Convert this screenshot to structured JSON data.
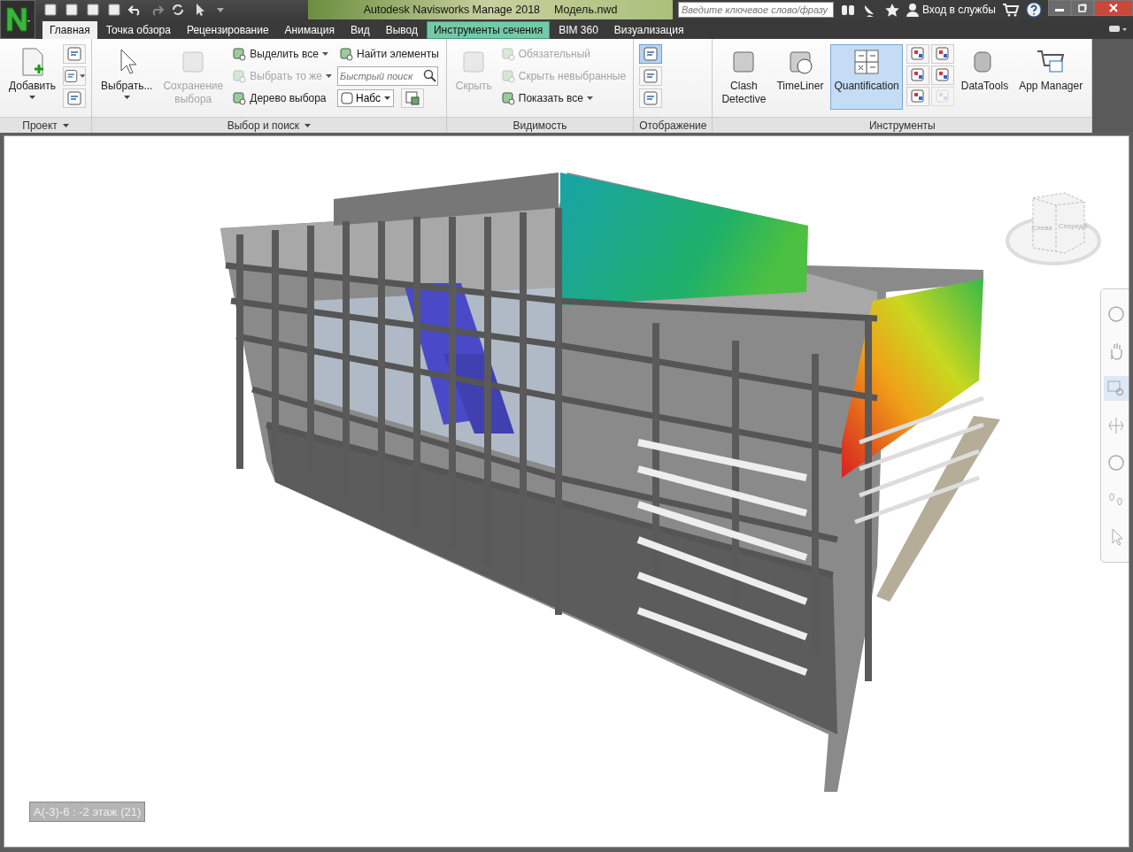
{
  "title_bar": {
    "title": "Autodesk Navisworks Manage 2018",
    "file": "Модель.nwd",
    "search": {
      "placeholder": "Введите ключевое слово/фразу"
    },
    "sign_in": "Вход в службы"
  },
  "tabs": [
    {
      "label": "Главная",
      "selected": true,
      "highlighted": false
    },
    {
      "label": "Точка обзора",
      "selected": false,
      "highlighted": false
    },
    {
      "label": "Рецензирование",
      "selected": false,
      "highlighted": false
    },
    {
      "label": "Анимация",
      "selected": false,
      "highlighted": false
    },
    {
      "label": "Вид",
      "selected": false,
      "highlighted": false
    },
    {
      "label": "Вывод",
      "selected": false,
      "highlighted": false
    },
    {
      "label": "Инструменты сечения",
      "selected": false,
      "highlighted": true
    },
    {
      "label": "BIM 360",
      "selected": false,
      "highlighted": false
    },
    {
      "label": "Визуализация",
      "selected": false,
      "highlighted": false
    }
  ],
  "ribbon_panels": [
    {
      "label": "Проект",
      "menu": true,
      "groups": [
        {
          "kind": "large",
          "label": [
            "Добавить"
          ],
          "dropdown": true,
          "disabled": false,
          "selected": false
        },
        {
          "kind": "stack",
          "items": [
            {
              "kind": "icon",
              "dropdown": false,
              "disabled": false,
              "selected": false
            },
            {
              "kind": "icon",
              "dropdown": true,
              "disabled": false,
              "selected": false
            },
            {
              "kind": "icon",
              "dropdown": false,
              "disabled": false,
              "selected": false
            }
          ]
        }
      ]
    },
    {
      "label": "Выбор и поиск",
      "menu": true,
      "groups": [
        {
          "kind": "large",
          "label": [
            "Выбрать..."
          ],
          "dropdown": true,
          "disabled": false,
          "selected": false
        },
        {
          "kind": "large",
          "label": [
            "Сохранение",
            "выбора"
          ],
          "dropdown": false,
          "disabled": true,
          "selected": false
        },
        {
          "kind": "stack",
          "items": [
            {
              "kind": "small",
              "label": "Выделить все",
              "dropdown": true,
              "disabled": false
            },
            {
              "kind": "small",
              "label": "Выбрать то же",
              "dropdown": true,
              "disabled": true
            },
            {
              "kind": "small",
              "label": "Дерево выбора",
              "dropdown": false,
              "disabled": false
            }
          ]
        },
        {
          "kind": "stack",
          "items": [
            {
              "kind": "small",
              "label": "Найти элементы",
              "dropdown": false,
              "disabled": false
            },
            {
              "kind": "search",
              "placeholder": "Быстрый поиск"
            },
            {
              "kind": "row",
              "items": [
                {
                  "kind": "combo",
                  "value": "Набс"
                },
                {
                  "kind": "icon",
                  "dropdown": false,
                  "disabled": false,
                  "selected": false
                }
              ]
            }
          ]
        }
      ]
    },
    {
      "label": "Видимость",
      "menu": false,
      "groups": [
        {
          "kind": "large",
          "label": [
            "Скрыть"
          ],
          "dropdown": false,
          "disabled": true,
          "selected": false
        },
        {
          "kind": "stack",
          "items": [
            {
              "kind": "small",
              "label": "Обязательный",
              "dropdown": false,
              "disabled": true
            },
            {
              "kind": "small",
              "label": "Скрыть невыбранные",
              "dropdown": false,
              "disabled": true
            },
            {
              "kind": "small",
              "label": "Показать все",
              "dropdown": true,
              "disabled": false
            }
          ]
        }
      ]
    },
    {
      "label": "Отображение",
      "menu": false,
      "groups": [
        {
          "kind": "stack",
          "items": [
            {
              "kind": "icon",
              "dropdown": false,
              "disabled": false,
              "selected": true
            },
            {
              "kind": "icon",
              "dropdown": false,
              "disabled": false,
              "selected": false
            },
            {
              "kind": "icon",
              "dropdown": false,
              "disabled": false,
              "selected": false
            }
          ]
        }
      ]
    },
    {
      "label": "Инструменты",
      "menu": false,
      "groups": [
        {
          "kind": "large",
          "label": [
            "Clash",
            "Detective"
          ],
          "dropdown": false,
          "disabled": false,
          "selected": false
        },
        {
          "kind": "large",
          "label": [
            "TimeLiner"
          ],
          "dropdown": false,
          "disabled": false,
          "selected": false
        },
        {
          "kind": "large",
          "label": [
            "Quantification"
          ],
          "dropdown": false,
          "disabled": false,
          "selected": true
        },
        {
          "kind": "grid",
          "items": [
            {
              "disabled": false
            },
            {
              "disabled": false
            },
            {
              "disabled": false
            },
            {
              "disabled": false
            },
            {
              "disabled": false
            },
            {
              "disabled": true
            }
          ]
        },
        {
          "kind": "large",
          "label": [
            "DataTools"
          ],
          "dropdown": false,
          "disabled": false,
          "selected": false
        },
        {
          "kind": "large",
          "label": [
            "App Manager"
          ],
          "dropdown": false,
          "disabled": false,
          "selected": false
        }
      ]
    }
  ],
  "viewport": {
    "view_cube": {
      "faces": [
        "Слева",
        "Спереди"
      ]
    },
    "nav_bar": {
      "tools": [
        {
          "selected": false
        },
        {
          "selected": false
        },
        {
          "selected": true
        },
        {
          "selected": false
        },
        {
          "selected": false
        },
        {
          "selected": false
        },
        {
          "selected": false
        }
      ]
    },
    "status_label": "А(-3)-6 : -2 этаж (21)"
  }
}
